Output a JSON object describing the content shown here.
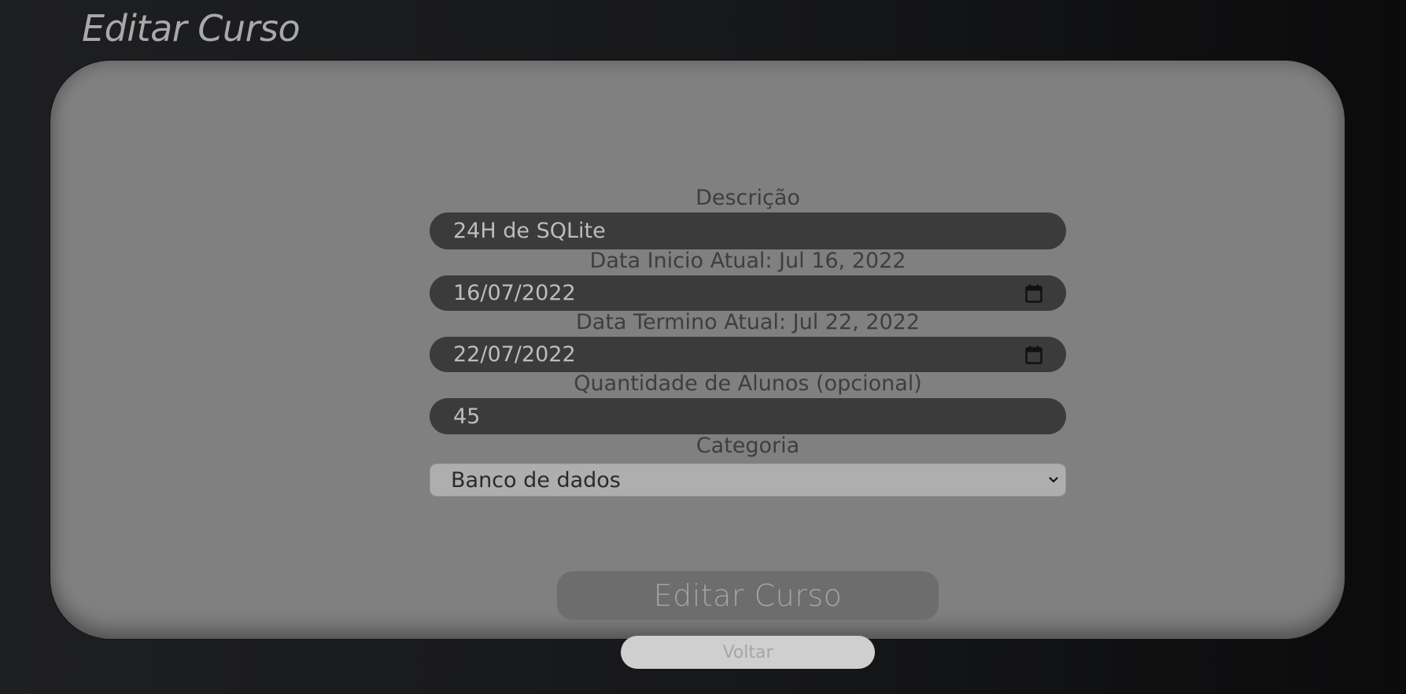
{
  "page": {
    "title": "Editar Curso"
  },
  "form": {
    "descricao": {
      "label": "Descrição",
      "value": "24H de SQLite"
    },
    "data_inicio": {
      "label": "Data Inicio Atual: Jul 16, 2022",
      "value": "16/07/2022",
      "icon": "calendar-icon"
    },
    "data_termino": {
      "label": "Data Termino Atual: Jul 22, 2022",
      "value": "22/07/2022",
      "icon": "calendar-icon"
    },
    "quantidade": {
      "label": "Quantidade de Alunos (opcional)",
      "value": "45"
    },
    "categoria": {
      "label": "Categoria",
      "selected": "Banco de dados",
      "icon": "chevron-down-icon"
    }
  },
  "actions": {
    "submit_label": "Editar Curso",
    "back_label": "Voltar"
  },
  "colors": {
    "background": "#161719",
    "card": "#808080",
    "input_bg": "#3b3b3b",
    "input_text": "#bdbdbd",
    "label_text": "#3e3e3e",
    "title_text": "#a9a9a9",
    "select_bg": "#aeaeae",
    "submit_bg": "#6d6d6d",
    "back_bg": "#cfcfcf"
  }
}
